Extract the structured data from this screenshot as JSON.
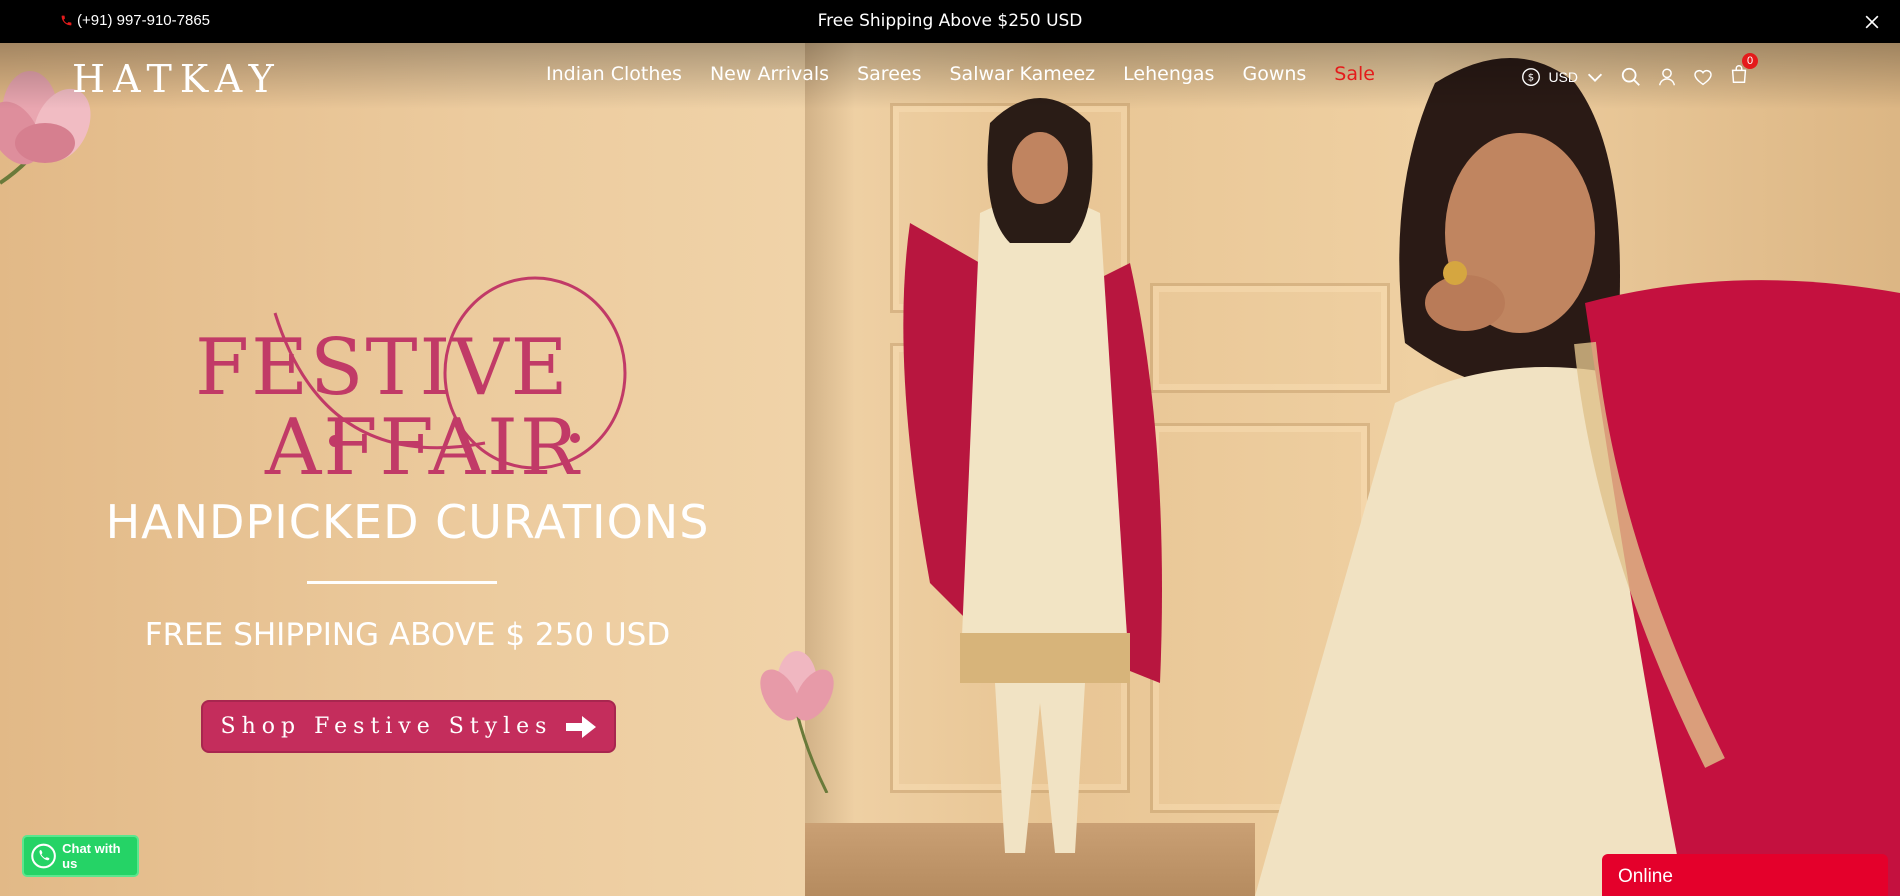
{
  "topbar": {
    "phone": "(+91) 997-910-7865",
    "promo": "Free Shipping Above $250 USD",
    "icons": {
      "phone": "phone-icon",
      "close": "close-icon"
    }
  },
  "header": {
    "logo": "HATKAY",
    "nav": [
      {
        "label": "Indian Clothes"
      },
      {
        "label": "New Arrivals"
      },
      {
        "label": "Sarees"
      },
      {
        "label": "Salwar Kameez"
      },
      {
        "label": "Lehengas"
      },
      {
        "label": "Gowns"
      },
      {
        "label": "Sale"
      }
    ],
    "currency": "USD",
    "cart_count": "0",
    "icons": [
      "currency-icon",
      "search-icon",
      "account-icon",
      "wishlist-icon",
      "cart-icon"
    ]
  },
  "hero": {
    "headline_line1": "FESTIVE",
    "headline_line2": "AFFAIR",
    "subhead": "HANDPICKED CURATIONS",
    "shipping": "FREE SHIPPING ABOVE $ 250 USD",
    "cta": "Shop Festive Styles"
  },
  "widgets": {
    "whatsapp": "Chat with us",
    "chat_status": "Online"
  },
  "colors": {
    "accent": "#c42d5c",
    "sale": "#e41b1b",
    "whatsapp": "#25d366",
    "chat": "#e4002b"
  }
}
